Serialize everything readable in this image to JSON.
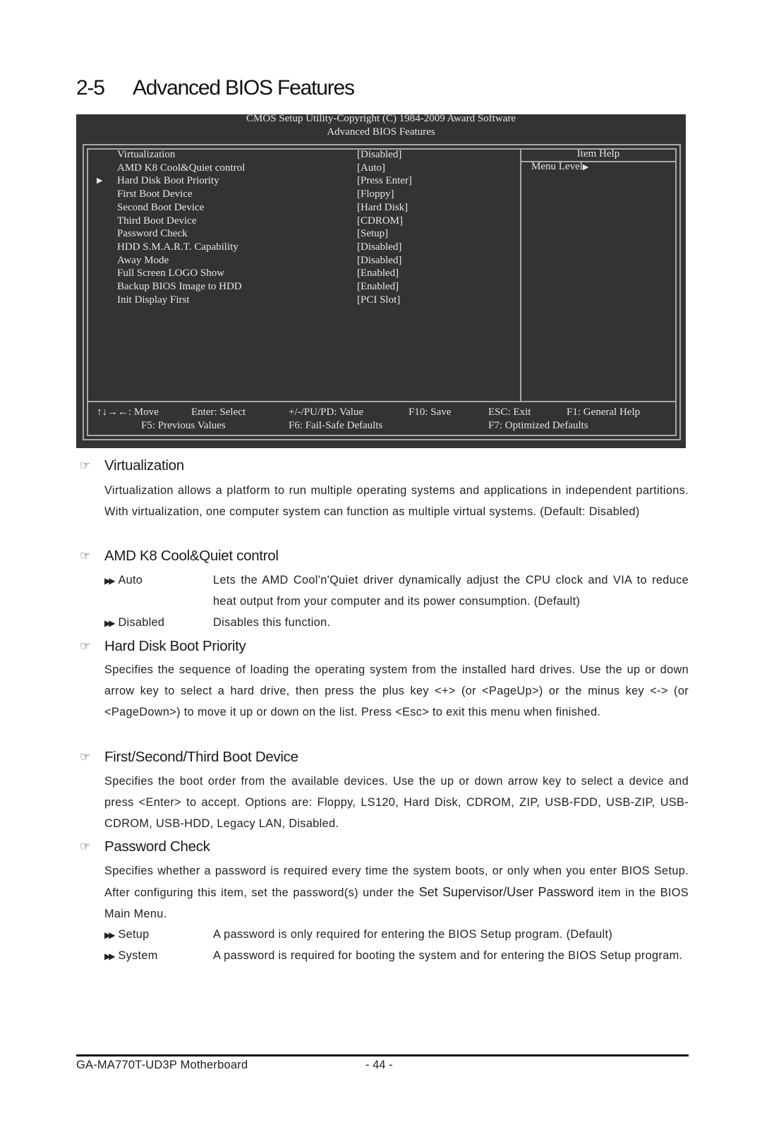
{
  "page": {
    "section_number": "2-5",
    "section_title": "Advanced BIOS Features"
  },
  "bios": {
    "header_line1": "CMOS Setup Utility-Copyright (C) 1984-2009 Award Software",
    "header_line2": "Advanced BIOS Features",
    "items": [
      {
        "label": "Virtualization",
        "value": "[Disabled]",
        "submenu": false
      },
      {
        "label": "AMD K8 Cool&Quiet control",
        "value": "[Auto]",
        "submenu": false
      },
      {
        "label": "Hard Disk Boot Priority",
        "value": "[Press Enter]",
        "submenu": true
      },
      {
        "label": "First Boot Device",
        "value": "[Floppy]",
        "submenu": false
      },
      {
        "label": "Second Boot Device",
        "value": "[Hard Disk]",
        "submenu": false
      },
      {
        "label": "Third Boot Device",
        "value": "[CDROM]",
        "submenu": false
      },
      {
        "label": "Password Check",
        "value": "[Setup]",
        "submenu": false
      },
      {
        "label": "HDD S.M.A.R.T. Capability",
        "value": "[Disabled]",
        "submenu": false
      },
      {
        "label": "Away Mode",
        "value": "[Disabled]",
        "submenu": false
      },
      {
        "label": "Full Screen LOGO Show",
        "value": "[Enabled]",
        "submenu": false
      },
      {
        "label": "Backup BIOS Image to HDD",
        "value": "[Enabled]",
        "submenu": false
      },
      {
        "label": "Init Display First",
        "value": "[PCI Slot]",
        "submenu": false
      }
    ],
    "submenu_arrow": "▶",
    "help_title": "Item Help",
    "help_menu_level": "Menu Level",
    "help_menu_arrow": "▶",
    "keys": {
      "move": "↑↓→←: Move",
      "select": "Enter: Select",
      "value": "+/-/PU/PD: Value",
      "save": "F10: Save",
      "exit": "ESC: Exit",
      "help": "F1: General Help",
      "previous": "F5: Previous Values",
      "failsafe": "F6: Fail-Safe Defaults",
      "optimized": "F7: Optimized Defaults"
    },
    "colors": {
      "background": "#333333",
      "text": "#e6e6e6",
      "border": "#a8a8a8"
    }
  },
  "sections": {
    "hand_icon": "☞",
    "bullet_icon": "▶▶",
    "virtualization": {
      "title": "Virtualization",
      "text": "Virtualization allows a platform to run multiple operating systems and applications in independent partitions. With virtualization, one computer system can function as multiple virtual systems. (Default: Disabled)"
    },
    "coolquiet": {
      "title": "AMD K8 Cool&Quiet control",
      "options": [
        {
          "name": "Auto",
          "desc": "Lets the AMD Cool'n'Quiet driver dynamically adjust the CPU clock and VIA to reduce heat output from your computer and its power consumption. (Default)"
        },
        {
          "name": "Disabled",
          "desc": "Disables this function."
        }
      ]
    },
    "hdd_priority": {
      "title": "Hard Disk Boot Priority",
      "text": "Specifies the sequence of loading the operating system from the installed hard drives.  Use the up or down arrow key to select a hard drive, then press the plus key <+> (or <PageUp>) or the minus key <-> (or <PageDown>) to move it up or down on the list. Press <Esc> to exit this menu when finished."
    },
    "boot_device": {
      "title": "First/Second/Third Boot Device",
      "text": "Specifies the boot order from the available devices. Use the up or down arrow key to select a device and press <Enter> to accept. Options are: Floppy, LS120, Hard Disk, CDROM, ZIP, USB-FDD, USB-ZIP, USB-CDROM, USB-HDD, Legacy LAN, Disabled."
    },
    "password": {
      "title": "Password Check",
      "text_a": "Specifies whether a password is required every time the system boots, or only when you enter BIOS Setup. After configuring this item, set the password(s) under the ",
      "text_highlight": "Set Supervisor/User Password",
      "text_b": " item in the BIOS Main Menu.",
      "options": [
        {
          "name": "Setup",
          "desc": "A password is only required for entering the BIOS Setup program. (Default)"
        },
        {
          "name": "System",
          "desc": "A password is required for booting the system and for entering the BIOS Setup program."
        }
      ]
    }
  },
  "footer": {
    "product": "GA-MA770T-UD3P Motherboard",
    "page_number": "- 44 -"
  }
}
